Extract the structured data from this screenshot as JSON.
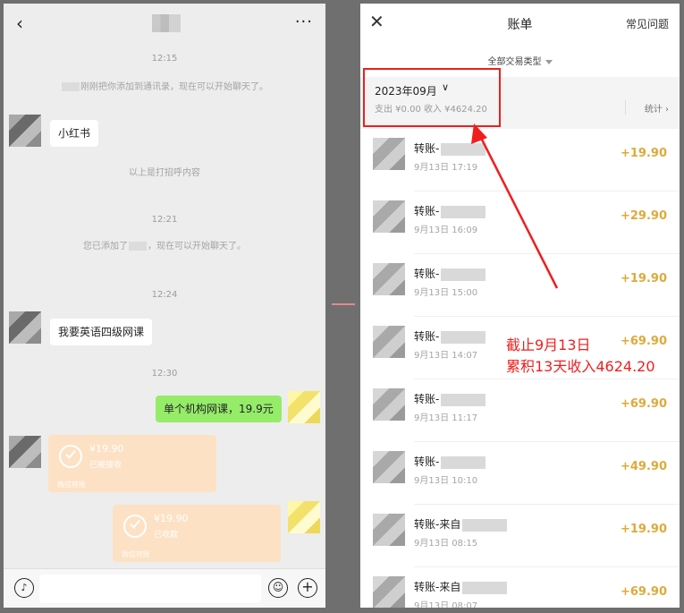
{
  "chat": {
    "times": [
      "12:15",
      "12:21",
      "12:24",
      "12:30"
    ],
    "system_added": "刚刚把你添加到通讯录，现在可以开始聊天了。",
    "greeting_message": "小红书",
    "greeting_note": "以上是打招呼内容",
    "system_added_2_prefix": "您已添加了",
    "system_added_2_suffix": "，现在可以开始聊天了。",
    "contact_message": "我要英语四级网课",
    "my_message": "单个机构网课，19.9元",
    "transfer_received": {
      "amount": "¥19.90",
      "status": "已被接收",
      "footer": "微信转账"
    },
    "transfer_sent": {
      "amount": "¥19.90",
      "status": "已收款",
      "footer": "微信转账"
    }
  },
  "bill": {
    "title": "账单",
    "faq": "常见问题",
    "type_filter": "全部交易类型",
    "month": "2023年09月",
    "summary": "支出 ¥0.00 收入 ¥4624.20",
    "stats": "统计",
    "transactions": [
      {
        "name": "转账-",
        "time": "9月13日 17:19",
        "amount": "+19.90"
      },
      {
        "name": "转账-",
        "time": "9月13日 16:09",
        "amount": "+29.90"
      },
      {
        "name": "转账-",
        "time": "9月13日 15:00",
        "amount": "+19.90"
      },
      {
        "name": "转账-",
        "time": "9月13日 14:07",
        "amount": "+69.90"
      },
      {
        "name": "转账-",
        "time": "9月13日 11:17",
        "amount": "+69.90"
      },
      {
        "name": "转账-",
        "time": "9月13日 10:10",
        "amount": "+49.90"
      },
      {
        "name": "转账-来自",
        "time": "9月13日 08:15",
        "amount": "+19.90"
      },
      {
        "name": "转账-来自",
        "time": "9月13日 08:07",
        "amount": "+69.90"
      }
    ]
  },
  "annotation": {
    "line1": "截止9月13日",
    "line2": "累积13天收入4624.20",
    "color": "#f01e1e"
  },
  "colors": {
    "accent_amount": "#e0a93a",
    "bubble_green": "#95ec69",
    "transfer": "#fde1c4"
  }
}
